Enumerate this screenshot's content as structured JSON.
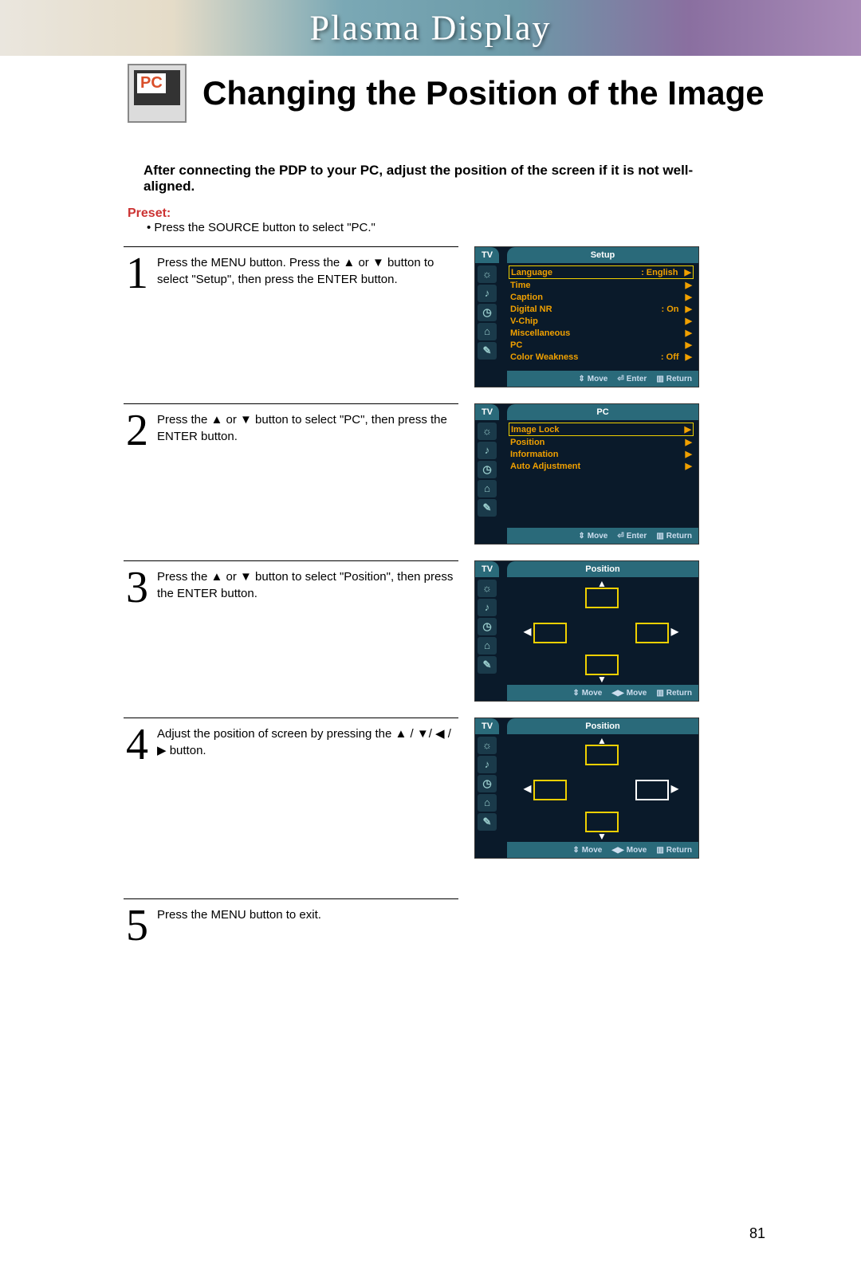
{
  "banner": {
    "title": "Plasma Display"
  },
  "header": {
    "badge": "PC",
    "title": "Changing the Position of the Image"
  },
  "intro": "After connecting the PDP to your PC, adjust the position of the screen if it is not well-aligned.",
  "preset": {
    "label": "Preset:",
    "text": "Press the SOURCE button to select \"PC.\""
  },
  "steps": {
    "s1": {
      "num": "1",
      "text": "Press the MENU button. Press the ▲ or ▼ button to select \"Setup\", then press the ENTER button."
    },
    "s2": {
      "num": "2",
      "text": "Press the ▲ or ▼ button to select \"PC\", then press the ENTER button."
    },
    "s3": {
      "num": "3",
      "text": "Press the ▲ or ▼ button to select \"Position\", then press the ENTER button."
    },
    "s4": {
      "num": "4",
      "text": "Adjust the position of screen by pressing the ▲ / ▼/ ◀ / ▶ button."
    },
    "s5": {
      "num": "5",
      "text": "Press the MENU button to exit."
    }
  },
  "osd_shared": {
    "tv_label": "TV",
    "footer_move_v": "Move",
    "footer_move_h": "Move",
    "footer_enter": "Enter",
    "footer_return": "Return"
  },
  "osd1": {
    "title": "Setup",
    "rows": [
      {
        "label": "Language",
        "value": ": English",
        "sel": true
      },
      {
        "label": "Time",
        "value": ""
      },
      {
        "label": "Caption",
        "value": ""
      },
      {
        "label": "Digital NR",
        "value": ": On"
      },
      {
        "label": "V-Chip",
        "value": ""
      },
      {
        "label": "Miscellaneous",
        "value": ""
      },
      {
        "label": "PC",
        "value": ""
      },
      {
        "label": "Color Weakness",
        "value": ": Off"
      }
    ]
  },
  "osd2": {
    "title": "PC",
    "rows": [
      {
        "label": "Image Lock",
        "value": "",
        "sel": true
      },
      {
        "label": "Position",
        "value": ""
      },
      {
        "label": "Information",
        "value": ""
      },
      {
        "label": "Auto Adjustment",
        "value": ""
      }
    ]
  },
  "osd3": {
    "title": "Position"
  },
  "osd4": {
    "title": "Position"
  },
  "page_number": "81"
}
